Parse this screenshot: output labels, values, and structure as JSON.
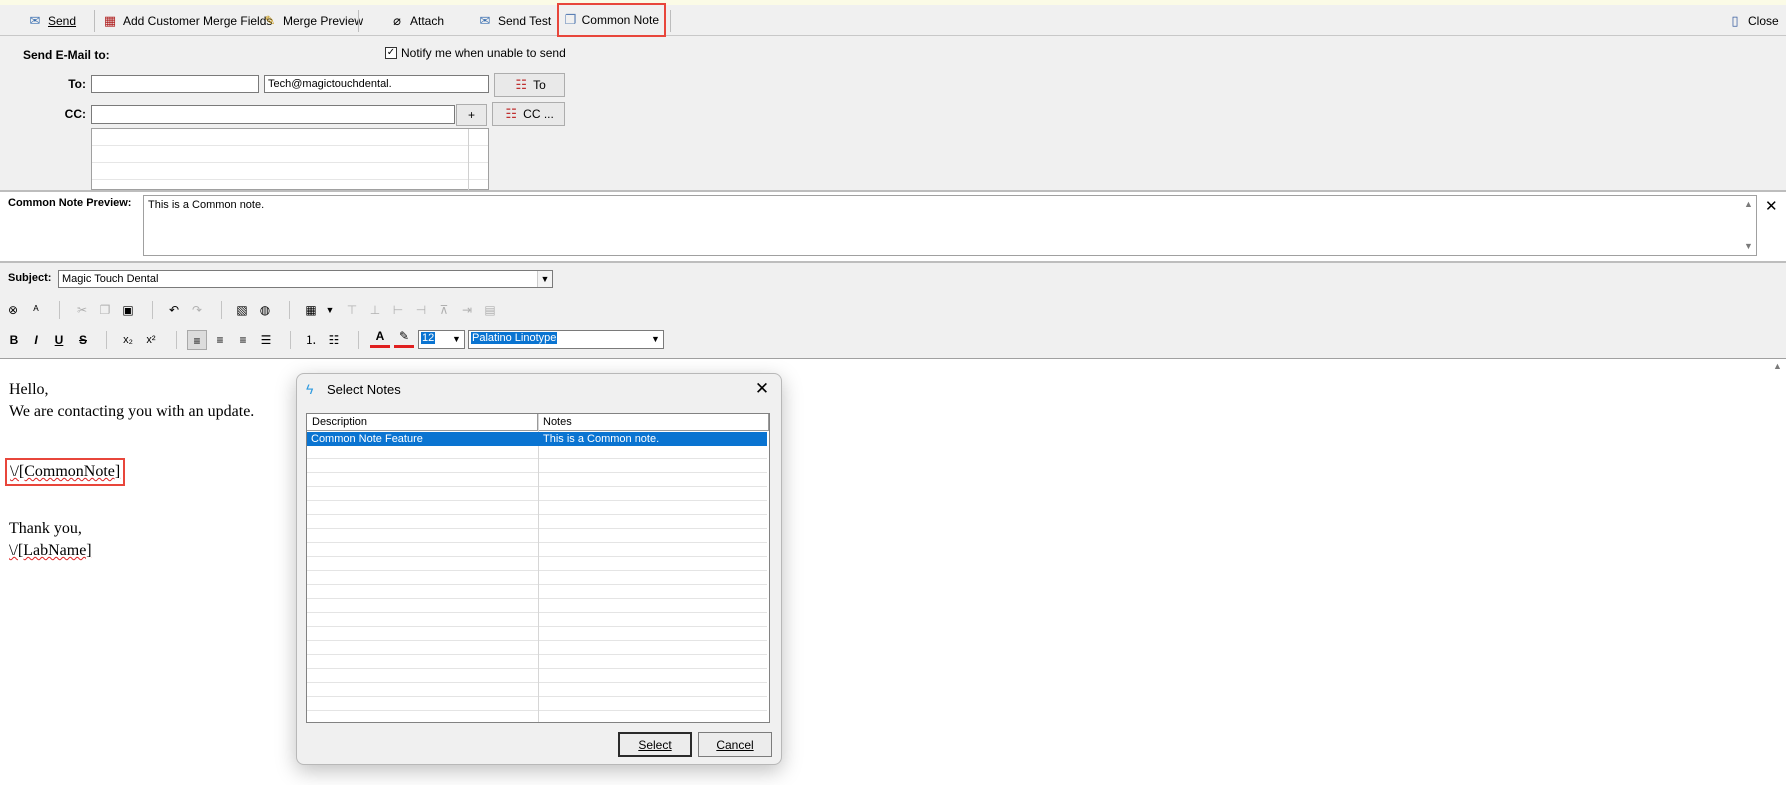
{
  "toolbar": {
    "send": "Send",
    "add_merge_fields": "Add Customer Merge Fields",
    "merge_preview": "Merge Preview",
    "attach": "Attach",
    "send_test": "Send Test",
    "common_note": "Common Note",
    "close": "Close"
  },
  "header": {
    "send_to_label": "Send E-Mail to:",
    "notify_label": "Notify me when unable to send",
    "notify_checked": "✓",
    "to_label": "To:",
    "to_name_value": "",
    "to_email_value": "Tech@magictouchdental.",
    "to_button": "To",
    "cc_label": "CC:",
    "cc_value": "",
    "cc_add": "+",
    "cc_button": "CC ..."
  },
  "preview": {
    "label": "Common Note Preview:",
    "text": "This is a Common note.",
    "close": "✕"
  },
  "subject": {
    "label": "Subject:",
    "value": "Magic Touch Dental"
  },
  "format": {
    "font_size": "12",
    "font_family": "Palatino Linotype"
  },
  "editor": {
    "lines": [
      "Hello,",
      "We are contacting you with an update.",
      "\\/[CommonNote]",
      "Thank you,",
      "\\/[LabName]"
    ]
  },
  "dialog": {
    "title": "Select Notes",
    "columns": [
      "Description",
      "Notes"
    ],
    "rows": [
      {
        "description": "Common Note Feature",
        "notes": "This is a Common note."
      }
    ],
    "select_button": "Select",
    "cancel_button": "Cancel"
  },
  "colors": {
    "highlight": "#e8463b",
    "selection": "#0a74d1",
    "font_color_bar": "#e02020"
  }
}
